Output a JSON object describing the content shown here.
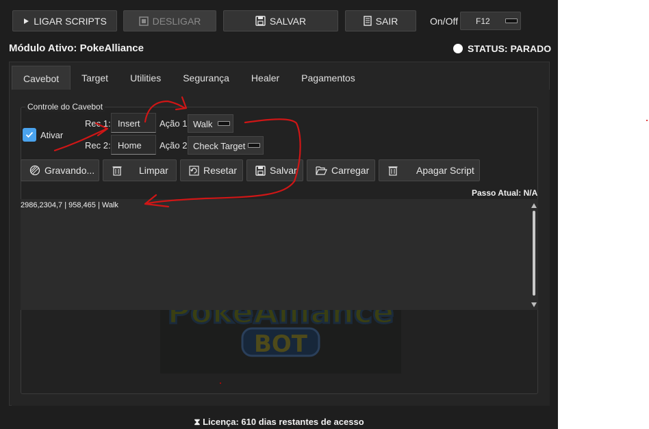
{
  "toolbar": {
    "start_label": "LIGAR SCRIPTS",
    "stop_label": "DESLIGAR",
    "save_label": "SALVAR",
    "exit_label": "SAIR",
    "onoff_label": "On/Off",
    "hotkey_value": "F12"
  },
  "header": {
    "module_title": "Módulo Ativo: PokeAlliance",
    "status": "STATUS: PARADO"
  },
  "tabs": [
    {
      "label": "Cavebot"
    },
    {
      "label": "Target"
    },
    {
      "label": "Utilities"
    },
    {
      "label": "Segurança"
    },
    {
      "label": "Healer"
    },
    {
      "label": "Pagamentos"
    }
  ],
  "cavebot": {
    "group_title": "Controle do Cavebot",
    "enable_label": "Ativar",
    "enable_checked": true,
    "rec1_label": "Rec 1:",
    "rec1_value": "Insert",
    "action1_label": "Ação 1:",
    "action1_value": "Walk",
    "rec2_label": "Rec 2:",
    "rec2_value": "Home",
    "action2_label": "Ação 2:",
    "action2_value": "Check Target",
    "buttons": {
      "record": "Gravando...",
      "clear": "Limpar",
      "reset": "Resetar",
      "save": "Salvar",
      "load": "Carregar",
      "delete_script": "Apagar Script"
    },
    "current_step": "Passo Atual: N/A",
    "script_lines": [
      "2986,2304,7 | 958,465 | Walk"
    ]
  },
  "logo": {
    "text": "PokeAlliance",
    "subtext": "BOT"
  },
  "footer": {
    "license": "Licença: 610 dias restantes de acesso"
  },
  "colors": {
    "accent": "#4aa3ee",
    "background": "#1e1e1e",
    "annotation": "#d00000"
  }
}
